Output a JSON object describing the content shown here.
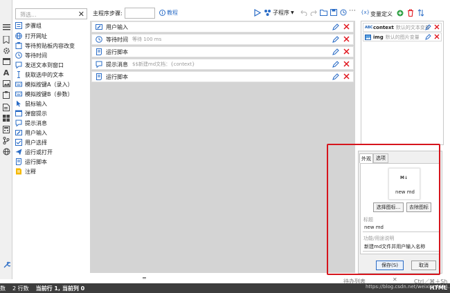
{
  "toolbox": {
    "search_placeholder": "筛选...",
    "items": [
      {
        "label": "步骤组",
        "icon": "step-group-icon"
      },
      {
        "label": "打开网址",
        "icon": "globe-icon"
      },
      {
        "label": "等待剪贴板内容改变",
        "icon": "clipboard-icon"
      },
      {
        "label": "等待时间",
        "icon": "clock-icon"
      },
      {
        "label": "发送文本到窗口",
        "icon": "send-text-icon"
      },
      {
        "label": "获取选中的文本",
        "icon": "text-cursor-icon"
      },
      {
        "label": "模拟按键A（录入）",
        "icon": "keyboard-icon"
      },
      {
        "label": "模拟按键B（参数）",
        "icon": "keyboard-icon"
      },
      {
        "label": "鼠标输入",
        "icon": "mouse-pointer-icon"
      },
      {
        "label": "弹窗提示",
        "icon": "popup-icon"
      },
      {
        "label": "提示消息",
        "icon": "message-icon"
      },
      {
        "label": "用户输入",
        "icon": "user-input-icon"
      },
      {
        "label": "用户选择",
        "icon": "user-select-icon"
      },
      {
        "label": "运行或打开",
        "icon": "paper-plane-icon"
      },
      {
        "label": "运行脚本",
        "icon": "script-icon"
      },
      {
        "label": "注释",
        "icon": "note-icon"
      }
    ]
  },
  "main": {
    "step_label": "主程序步骤:",
    "tutorial": "教程",
    "subprogram": "子程序",
    "steps": [
      {
        "name": "用户输入",
        "desc": "",
        "icon": "user-input-icon"
      },
      {
        "name": "等待时间",
        "desc": "等待 100 ms",
        "icon": "clock-icon"
      },
      {
        "name": "运行脚本",
        "desc": "",
        "icon": "script-icon"
      },
      {
        "name": "提示消息",
        "desc": "$$新建md文档：{context}",
        "icon": "message-icon"
      },
      {
        "name": "运行脚本",
        "desc": "",
        "icon": "script-icon"
      }
    ]
  },
  "vars": {
    "title": "变量定义",
    "items": [
      {
        "type": "ABC",
        "name": "context",
        "desc": "默认的文本变量"
      },
      {
        "type": "IMG",
        "name": "img",
        "desc": "默认的图片变量"
      }
    ]
  },
  "props": {
    "tab_appearance": "外观",
    "tab_options": "选项",
    "icon_text": "M↓",
    "icon_name": "new md",
    "choose_icon": "选择图标...",
    "remove_icon": "去除图标",
    "title_label": "标题",
    "title_value": "new md",
    "desc_label": "功能/用途说明",
    "desc_value": "新建md文件并用户输入名称",
    "save": "保存(S)",
    "cancel": "取消"
  },
  "bottom": {
    "collapse": "═",
    "hint": "待办列表",
    "status_count": "数",
    "status_rows": "2 行数",
    "status_pos": "当前行 1, 当前列 0",
    "watermark": "https://blog.csdn.net/weixin_4494...",
    "lang": "HTML",
    "shortcut": "Ctrl／⌘＋Sh"
  },
  "colors": {
    "accent": "#2a6cc6",
    "delete": "#e0141c",
    "highlight_box": "#d6141c"
  }
}
